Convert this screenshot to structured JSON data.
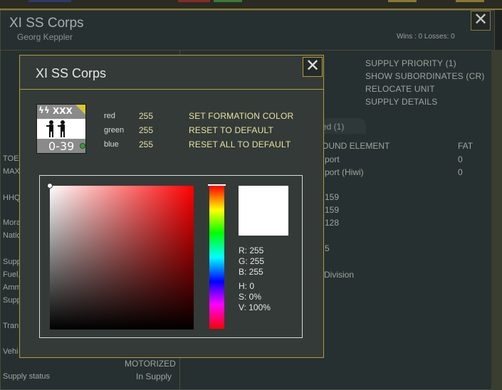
{
  "background_window": {
    "title": "XI SS Corps",
    "commander": "Georg Keppler",
    "wins_losses": "Wins : 0  Losses: 0",
    "close_glyph": "✕",
    "menu": [
      "SUPPLY PRIORITY (1)",
      "SHOW SUBORDINATES (CR)",
      "RELOCATE UNIT",
      "SUPPLY DETAILS"
    ],
    "tab_label": "ed (1)",
    "table": {
      "headers": [
        "OUND ELEMENT",
        "FAT"
      ],
      "rows": [
        [
          "port",
          "0"
        ],
        [
          "port (Hiwi)",
          "0"
        ]
      ]
    },
    "partial_values": [
      "159",
      "159",
      "128",
      "5"
    ],
    "partial_division": "Division",
    "left_labels": [
      "TOE",
      "MAX",
      "HHQ",
      "Mora",
      "Natio",
      "Supp",
      "Fuel,",
      "Amm",
      "Supp",
      "Tran",
      "Vehi",
      "Supply status"
    ],
    "motorized": "MOTORIZED",
    "supply_status": "In Supply"
  },
  "dialog": {
    "title": "XI SS Corps",
    "close_glyph": "✕",
    "unit_icon": {
      "size_marker": "XXX",
      "insignia": "ϟϟ",
      "strength": "0-39",
      "figures_glyph": "🯅🯅"
    },
    "rgb": [
      {
        "label": "red",
        "value": "255"
      },
      {
        "label": "green",
        "value": "255"
      },
      {
        "label": "blue",
        "value": "255"
      }
    ],
    "actions": [
      "SET FORMATION COLOR",
      "RESET TO DEFAULT",
      "RESET ALL TO DEFAULT"
    ],
    "color_picker": {
      "selected_color": "#ffffff",
      "hue_degrees": 0,
      "saturation_percent": 0,
      "value_percent": 100,
      "readout": {
        "r": "R: 255",
        "g": "G: 255",
        "b": "B: 255",
        "h": "H: 0",
        "s": "S: 0%",
        "v": "V: 100%"
      }
    }
  },
  "colors": {
    "accent_border": "#b59b3a",
    "action_text": "#e8e4a0",
    "dialog_bg": "#343a38"
  },
  "icons": [
    "close-icon",
    "unit-counter-icon",
    "status-dot-icon"
  ]
}
